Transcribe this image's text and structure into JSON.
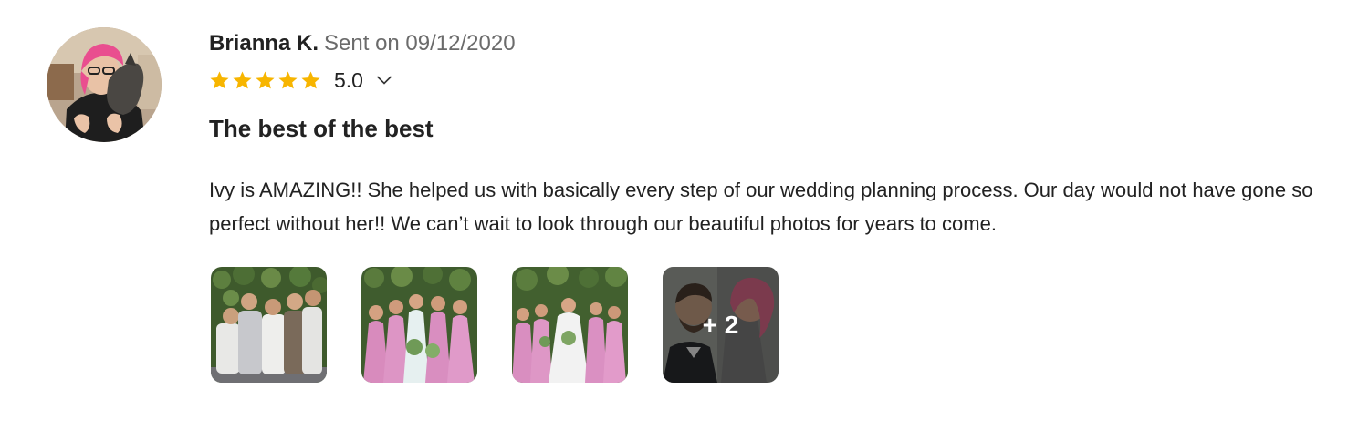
{
  "reviewer": {
    "name": "Brianna K.",
    "sent_text": "Sent on 09/12/2020"
  },
  "rating": {
    "value": "5.0",
    "stars": 5,
    "max_stars": 5,
    "star_color": "#f7b500"
  },
  "review": {
    "title": "The best of the best",
    "body": "Ivy is AMAZING!! She helped us with basically every step of our wedding planning process. Our day would not have gone so perfect without her!! We can’t wait to look through our beautiful photos for years to come."
  },
  "photos": {
    "more_label": "+ 2"
  },
  "icons": {
    "star": "star-icon",
    "expand": "chevron-down-icon"
  }
}
